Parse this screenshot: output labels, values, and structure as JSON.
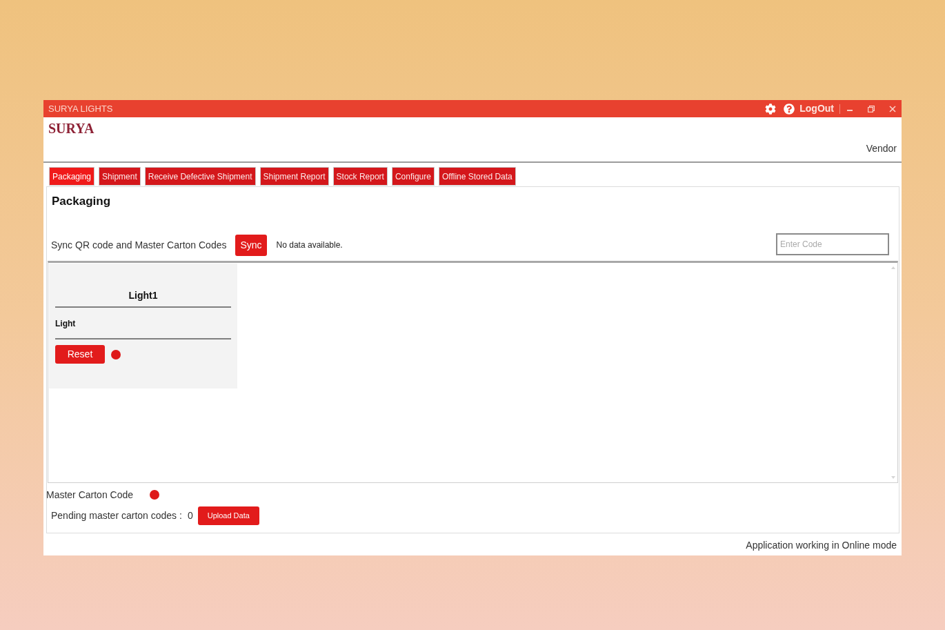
{
  "window": {
    "title": "SURYA LIGHTS",
    "logout": "LogOut"
  },
  "header": {
    "logo": "SURYA",
    "user_role": "Vendor"
  },
  "tabs": [
    {
      "label": "Packaging",
      "selected": true
    },
    {
      "label": "Shipment",
      "selected": false
    },
    {
      "label": "Receive Defective Shipment",
      "selected": false
    },
    {
      "label": "Shipment Report",
      "selected": false
    },
    {
      "label": "Stock Report",
      "selected": false
    },
    {
      "label": "Configure",
      "selected": false
    },
    {
      "label": "Offline Stored Data",
      "selected": false
    }
  ],
  "page": {
    "title": "Packaging",
    "sync": {
      "label": "Sync QR code and Master Carton Codes",
      "button": "Sync",
      "message": "No data available."
    },
    "code_field": {
      "placeholder": "Enter Code"
    }
  },
  "cards": [
    {
      "title": "Light1",
      "subtitle": "Light",
      "button": "Reset",
      "color": "#de1a1a"
    }
  ],
  "master_carton": {
    "label": "Master Carton Code",
    "color": "#de1a1a"
  },
  "pending": {
    "label": "Pending master carton codes :",
    "count": "0",
    "button": "Upload Data"
  },
  "status_bar": {
    "text": "Application working in Online mode"
  }
}
